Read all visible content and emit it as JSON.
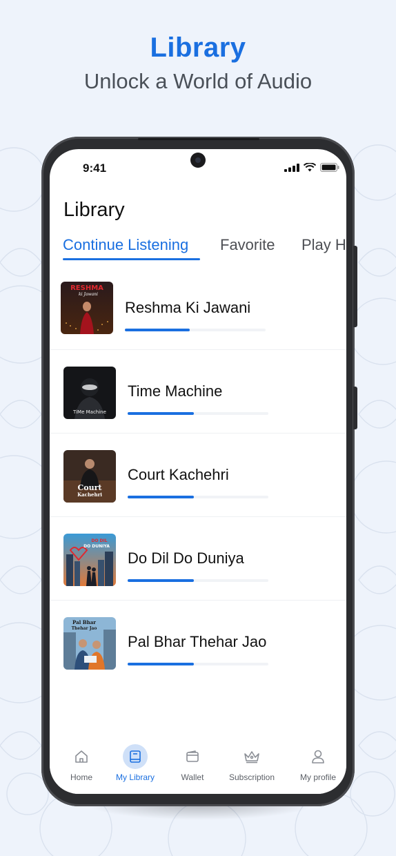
{
  "hero": {
    "title": "Library",
    "subtitle": "Unlock a World of Audio"
  },
  "status_bar": {
    "time": "9:41"
  },
  "page": {
    "title": "Library"
  },
  "tabs": [
    {
      "label": "Continue Listening",
      "active": true
    },
    {
      "label": "Favorite",
      "active": false
    },
    {
      "label": "Play History",
      "active": false
    }
  ],
  "items": [
    {
      "title": "Reshma Ki Jawani",
      "progress": 0.46,
      "cover_text": "RESHMA",
      "cover_subtext": "ki Jawani"
    },
    {
      "title": "Time Machine",
      "progress": 0.47,
      "cover_text": "TiMe Machine"
    },
    {
      "title": "Court Kachehri",
      "progress": 0.47,
      "cover_text": "Court",
      "cover_subtext": "Kachehri"
    },
    {
      "title": "Do Dil Do Duniya",
      "progress": 0.47,
      "cover_text": "DO DIL",
      "cover_subtext": "DO DUNIYA"
    },
    {
      "title": "Pal Bhar Thehar Jao",
      "progress": 0.47,
      "cover_text": "Pal Bhar",
      "cover_subtext": "Thehar Jao"
    }
  ],
  "bottom_nav": [
    {
      "label": "Home",
      "icon": "home-icon",
      "active": false
    },
    {
      "label": "My Library",
      "icon": "library-icon",
      "active": true
    },
    {
      "label": "Wallet",
      "icon": "wallet-icon",
      "active": false
    },
    {
      "label": "Subscription",
      "icon": "crown-icon",
      "active": false
    },
    {
      "label": "My profile",
      "icon": "profile-icon",
      "active": false
    }
  ],
  "colors": {
    "accent": "#1a6fe0",
    "background": "#eef3fb",
    "nav_active_bg": "#cfe0f8"
  }
}
